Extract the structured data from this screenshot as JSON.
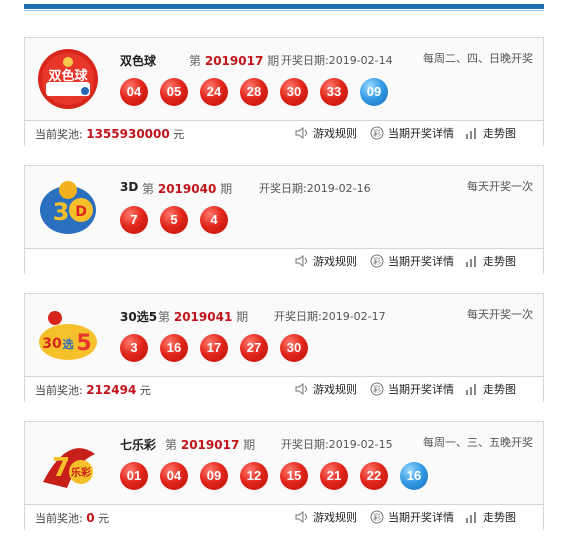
{
  "accent_color": "#1e6fb5",
  "ball_red": "#e3271b",
  "ball_blue": "#2f98e2",
  "labels": {
    "issue_prefix": "第",
    "issue_suffix": "期",
    "pool_label": "当前奖池:",
    "pool_unit": "元",
    "rules": "游戏规则",
    "details": "当期开奖详情",
    "trend": "走势图"
  },
  "lotteries": [
    {
      "name": "双色球",
      "issue": "2019017",
      "date": "开奖日期:2019-02-14",
      "frequency": "每周二、四、日晚开奖",
      "red_balls": [
        "04",
        "05",
        "24",
        "28",
        "30",
        "33"
      ],
      "blue_balls": [
        "09"
      ],
      "pool": "1355930000",
      "logo": "ssq-logo-icon"
    },
    {
      "name": "3D",
      "issue": "2019040",
      "date": "开奖日期:2019-02-16",
      "frequency": "每天开奖一次",
      "red_balls": [
        "7",
        "5",
        "4"
      ],
      "blue_balls": [],
      "pool": null,
      "logo": "3d-logo-icon"
    },
    {
      "name": "30选5",
      "issue": "2019041",
      "date": "开奖日期:2019-02-17",
      "frequency": "每天开奖一次",
      "red_balls": [
        "3",
        "16",
        "17",
        "27",
        "30"
      ],
      "blue_balls": [],
      "pool": "212494",
      "logo": "30x5-logo-icon"
    },
    {
      "name": "七乐彩",
      "issue": "2019017",
      "date": "开奖日期:2019-02-15",
      "frequency": "每周一、三、五晚开奖",
      "red_balls": [
        "01",
        "04",
        "09",
        "12",
        "15",
        "21",
        "22"
      ],
      "blue_balls": [
        "16"
      ],
      "pool": "0",
      "logo": "qlc-logo-icon"
    }
  ]
}
